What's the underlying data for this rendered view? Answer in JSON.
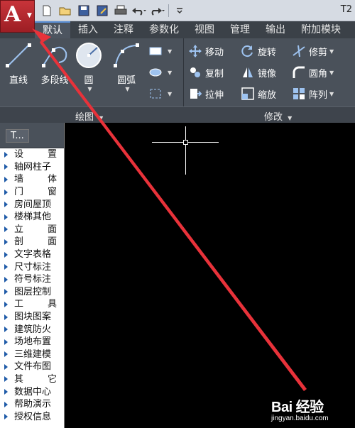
{
  "app": {
    "logo_letter": "A",
    "doc_title": "T2"
  },
  "quick_access": [
    "new-icon",
    "open-icon",
    "save-icon",
    "saveas-icon",
    "print-icon",
    "undo-icon",
    "redo-icon",
    "customize-icon"
  ],
  "tabs": [
    {
      "label": "默认",
      "active": true
    },
    {
      "label": "插入"
    },
    {
      "label": "注释"
    },
    {
      "label": "参数化"
    },
    {
      "label": "视图"
    },
    {
      "label": "管理"
    },
    {
      "label": "输出"
    },
    {
      "label": "附加模块"
    }
  ],
  "draw_panel": {
    "title": "绘图",
    "tools": {
      "line": "直线",
      "polyline": "多段线",
      "circle": "圆",
      "arc": "圆弧"
    }
  },
  "modify_panel": {
    "title": "修改",
    "tools": {
      "move": "移动",
      "rotate": "旋转",
      "trim": "修剪",
      "copy": "复制",
      "mirror": "镜像",
      "fillet": "圆角",
      "stretch": "拉伸",
      "scale": "缩放",
      "array": "阵列"
    }
  },
  "palette": {
    "title": "T...",
    "items": [
      {
        "label": "设置",
        "spaced": true
      },
      {
        "label": "轴网柱子"
      },
      {
        "label": "墙体",
        "spaced": true
      },
      {
        "label": "门窗",
        "spaced": true
      },
      {
        "label": "房间屋顶"
      },
      {
        "label": "楼梯其他"
      },
      {
        "label": "立面",
        "spaced": true
      },
      {
        "label": "剖面",
        "spaced": true
      },
      {
        "label": "文字表格"
      },
      {
        "label": "尺寸标注"
      },
      {
        "label": "符号标注"
      },
      {
        "label": "图层控制"
      },
      {
        "label": "工具",
        "spaced": true
      },
      {
        "label": "图块图案"
      },
      {
        "label": "建筑防火"
      },
      {
        "label": "场地布置"
      },
      {
        "label": "三维建模"
      },
      {
        "label": "文件布图"
      },
      {
        "label": "其它",
        "spaced": true
      },
      {
        "label": "数据中心"
      },
      {
        "label": "帮助演示"
      },
      {
        "label": "授权信息"
      }
    ]
  },
  "watermark": {
    "brand": "Bai 经验",
    "url": "jingyan.baidu.com"
  },
  "colors": {
    "ribbon": "#4a515a",
    "tabs": "#3b4148",
    "canvas": "#000000",
    "arrow": "#e8323a",
    "app_button": "#c8343a"
  }
}
